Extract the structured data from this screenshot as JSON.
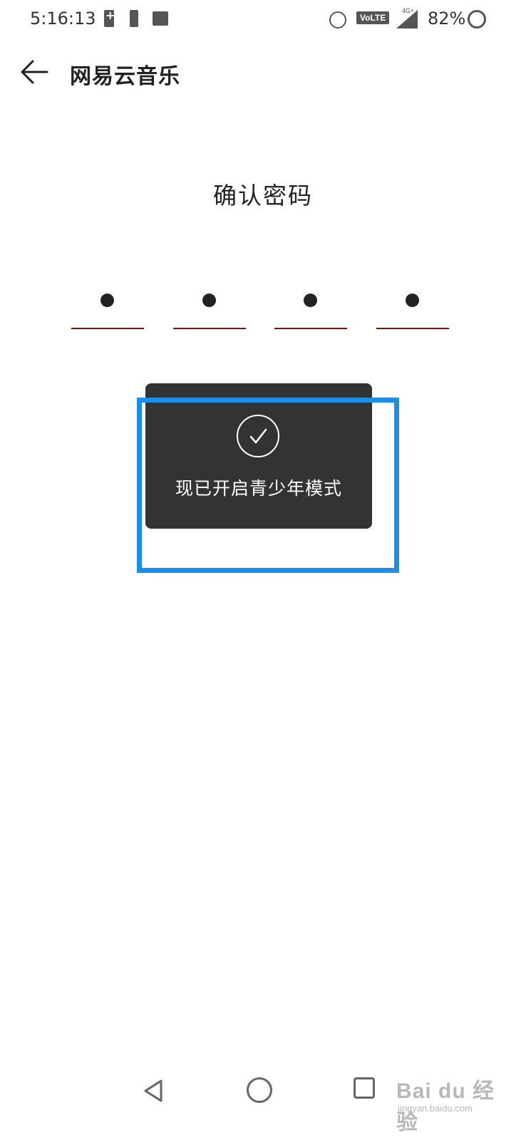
{
  "status_bar": {
    "time": "5:16:13",
    "volte": "VoLTE",
    "network": "4G+",
    "battery_percent": "82%"
  },
  "app_bar": {
    "title": "网易云音乐"
  },
  "password": {
    "heading": "确认密码",
    "digits_entered": 4
  },
  "toast": {
    "message": "现已开启青少年模式"
  },
  "watermark": {
    "main": "Bai du 经验",
    "sub": "jingyan.baidu.com"
  },
  "colors": {
    "toast_bg": "#333333",
    "highlight": "#1a8ee8",
    "pin_underline": "#7a1212"
  }
}
